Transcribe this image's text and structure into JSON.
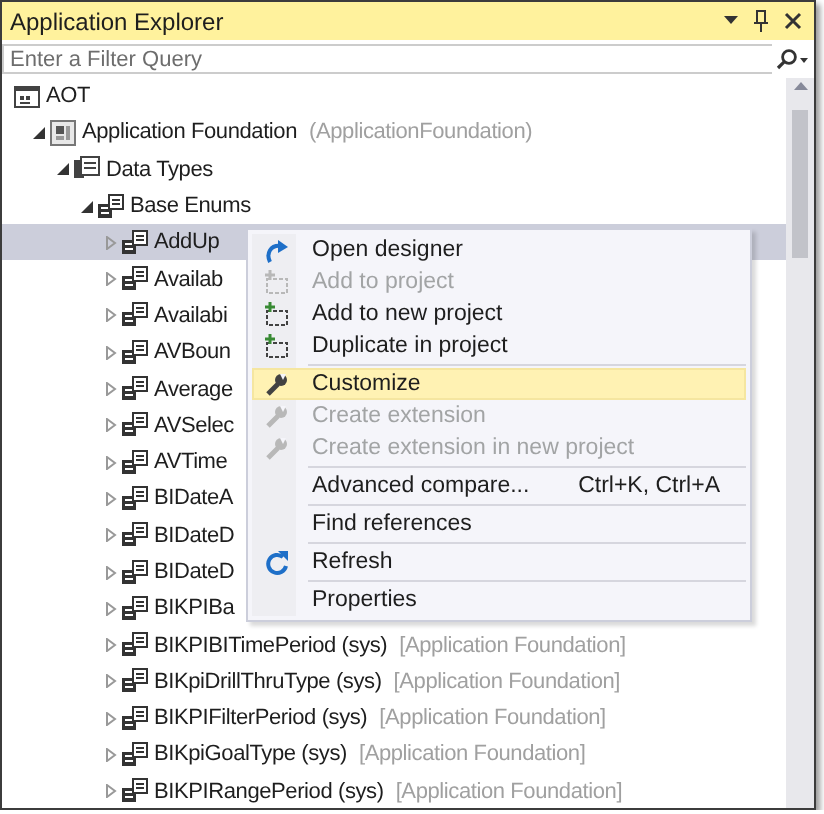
{
  "window": {
    "title": "Application Explorer"
  },
  "filter": {
    "placeholder": "Enter a Filter Query"
  },
  "tree": [
    {
      "label": "AOT",
      "kind": "aot",
      "selected": false,
      "children": [
        {
          "label": "Application Foundation",
          "note": "(ApplicationFoundation)",
          "kind": "model",
          "expanded": true,
          "selected": false,
          "children": [
            {
              "label": "Data Types",
              "kind": "folder",
              "expanded": true,
              "selected": false,
              "children": [
                {
                  "label": "Base Enums",
                  "kind": "enum",
                  "expanded": true,
                  "selected": false,
                  "children": [
                    {
                      "label": "AddUp",
                      "kind": "enum",
                      "expanded": false,
                      "selected": true
                    },
                    {
                      "label": "Availab",
                      "kind": "enum",
                      "expanded": false,
                      "selected": false
                    },
                    {
                      "label": "Availabi",
                      "kind": "enum",
                      "expanded": false,
                      "selected": false
                    },
                    {
                      "label": "AVBoun",
                      "kind": "enum",
                      "expanded": false,
                      "selected": false
                    },
                    {
                      "label": "Average",
                      "kind": "enum",
                      "expanded": false,
                      "selected": false
                    },
                    {
                      "label": "AVSelec",
                      "kind": "enum",
                      "expanded": false,
                      "selected": false
                    },
                    {
                      "label": "AVTime",
                      "kind": "enum",
                      "expanded": false,
                      "selected": false
                    },
                    {
                      "label": "BIDateA",
                      "kind": "enum",
                      "expanded": false,
                      "selected": false
                    },
                    {
                      "label": "BIDateD",
                      "kind": "enum",
                      "expanded": false,
                      "selected": false
                    },
                    {
                      "label": "BIDateD",
                      "kind": "enum",
                      "expanded": false,
                      "selected": false
                    },
                    {
                      "label": "BIKPIBa",
                      "kind": "enum",
                      "expanded": false,
                      "selected": false
                    },
                    {
                      "label": "BIKPIBITimePeriod (sys)",
                      "note": "[Application Foundation]",
                      "kind": "enum",
                      "expanded": false,
                      "selected": false
                    },
                    {
                      "label": "BIKpiDrillThruType (sys)",
                      "note": "[Application Foundation]",
                      "kind": "enum",
                      "expanded": false,
                      "selected": false
                    },
                    {
                      "label": "BIKPIFilterPeriod (sys)",
                      "note": "[Application Foundation]",
                      "kind": "enum",
                      "expanded": false,
                      "selected": false
                    },
                    {
                      "label": "BIKpiGoalType (sys)",
                      "note": "[Application Foundation]",
                      "kind": "enum",
                      "expanded": false,
                      "selected": false
                    },
                    {
                      "label": "BIKPIRangePeriod (sys)",
                      "note": "[Application Foundation]",
                      "kind": "enum",
                      "expanded": false,
                      "selected": false
                    }
                  ]
                }
              ]
            }
          ]
        }
      ]
    }
  ],
  "context_menu": [
    {
      "label": "Open designer",
      "kind": "designer",
      "disabled": false,
      "selected": false,
      "separator_after": false
    },
    {
      "label": "Add to project",
      "kind": "project",
      "disabled": true,
      "selected": false,
      "separator_after": false
    },
    {
      "label": "Add to new project",
      "kind": "project",
      "disabled": false,
      "selected": false,
      "separator_after": false
    },
    {
      "label": "Duplicate in project",
      "kind": "project",
      "disabled": false,
      "selected": false,
      "separator_after": true
    },
    {
      "label": "Customize",
      "kind": "wrench",
      "disabled": false,
      "selected": true,
      "separator_after": false
    },
    {
      "label": "Create extension",
      "kind": "wrench",
      "disabled": true,
      "selected": false,
      "separator_after": false
    },
    {
      "label": "Create extension in new project",
      "kind": "wrench",
      "disabled": true,
      "selected": false,
      "separator_after": true
    },
    {
      "label": "Advanced compare...",
      "shortcut": "Ctrl+K, Ctrl+A",
      "kind": "none",
      "disabled": false,
      "selected": false,
      "separator_after": true
    },
    {
      "label": "Find references",
      "kind": "none",
      "disabled": false,
      "selected": false,
      "separator_after": true
    },
    {
      "label": "Refresh",
      "kind": "refresh",
      "disabled": false,
      "selected": false,
      "separator_after": true
    },
    {
      "label": "Properties",
      "kind": "none",
      "disabled": false,
      "selected": false,
      "separator_after": false
    }
  ]
}
